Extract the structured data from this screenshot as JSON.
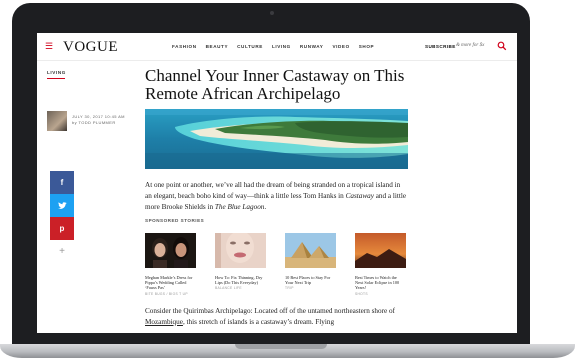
{
  "nav": {
    "menu_icon": "hamburger-icon",
    "logo": "VOGUE",
    "links": [
      "FASHION",
      "BEAUTY",
      "CULTURE",
      "LIVING",
      "RUNWAY",
      "VIDEO",
      "SHOP"
    ],
    "subscribe": "SUBSCRIBE",
    "offer": "& more for $x",
    "search_icon": "search-icon",
    "accent_color": "#d0021b"
  },
  "article": {
    "category": "LIVING",
    "date": "JULY 30, 2017 10:45 AM",
    "author": "by TODD PLUMMER",
    "headline": "Channel Your Inner Castaway on This Remote African Archipelago",
    "intro_a": "At one point or another, we’ve all had the dream of being stranded on a tropical island in an elegant, beach boho kind of way—think a little less Tom Hanks in ",
    "intro_italic_1": "Castaway",
    "intro_b": " and a little more Brooke Shields in ",
    "intro_italic_2": "The Blue Lagoon",
    "intro_c": ".",
    "para2_a": "Consider the Quirimbas Archipelago: Located off of the untamed northeastern shore of ",
    "para2_link": "Mozambique",
    "para2_b": ", this stretch of islands is a castaway’s dream. Flying"
  },
  "share": {
    "facebook": "f",
    "twitter": "t",
    "pinterest": "p",
    "more": "+",
    "colors": {
      "facebook": "#3b5998",
      "twitter": "#1da1f2",
      "pinterest": "#cb2027"
    }
  },
  "sponsored": {
    "label": "SPONSORED STORIES",
    "cards": [
      {
        "title": "Meghan Markle’s Dress for Pippa’s Wedding Called ‘Fauxs Pas’",
        "source": "BITE BUGS / BIOS T UP"
      },
      {
        "title": "How To: Fix Thinning, Dry Lips (Do This Everyday)",
        "source": "BALANCE LIFE"
      },
      {
        "title": "10 Best Places to Stay For Your Next Trip",
        "source": "TRIP"
      },
      {
        "title": "Best Times to Watch the Next Solar Eclipse in 100 Years!",
        "source": "SHOTS"
      }
    ]
  }
}
